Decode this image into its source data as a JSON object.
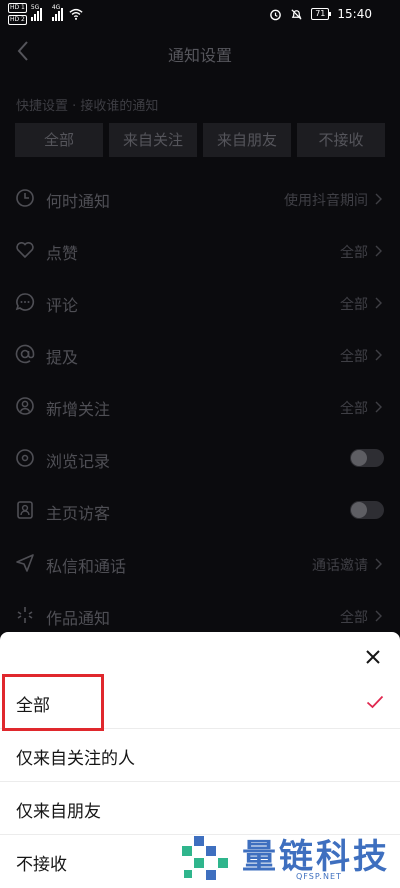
{
  "status_bar": {
    "hd1": "HD 1",
    "hd2": "HD 2",
    "net1": "5G",
    "net2": "4G",
    "battery": "71",
    "time": "15:40"
  },
  "header": {
    "title": "通知设置"
  },
  "quick_settings": {
    "label": "快捷设置 · 接收谁的通知",
    "chips": [
      "全部",
      "来自关注",
      "来自朋友",
      "不接收"
    ]
  },
  "rows": [
    {
      "label": "何时通知",
      "value": "使用抖音期间",
      "icon": "clock-icon"
    },
    {
      "label": "点赞",
      "value": "全部",
      "icon": "heart-icon"
    },
    {
      "label": "评论",
      "value": "全部",
      "icon": "comment-icon"
    },
    {
      "label": "提及",
      "value": "全部",
      "icon": "at-icon"
    },
    {
      "label": "新增关注",
      "value": "全部",
      "icon": "person-icon"
    },
    {
      "label": "浏览记录",
      "value": "",
      "icon": "eye-icon",
      "toggle": false
    },
    {
      "label": "主页访客",
      "value": "",
      "icon": "profile-card-icon",
      "toggle": false
    },
    {
      "label": "私信和通话",
      "value": "通话邀请",
      "icon": "send-icon"
    },
    {
      "label": "作品通知",
      "value": "全部",
      "icon": "sparkle-icon"
    }
  ],
  "sheet": {
    "options": [
      "全部",
      "仅来自关注的人",
      "仅来自朋友",
      "不接收"
    ],
    "selected": "全部",
    "check_color": "#e0284f"
  },
  "watermark": {
    "text": "量链科技",
    "subtext": "QFSP.NET"
  },
  "colors": {
    "highlight": "#e0282d",
    "watermark": "#3e6fbf"
  }
}
